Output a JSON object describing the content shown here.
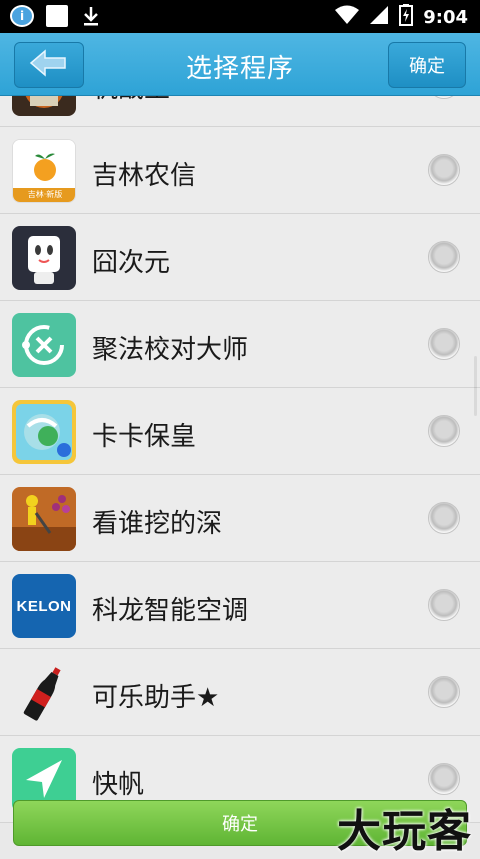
{
  "status_bar": {
    "time": "9:04",
    "notification_badge": "i",
    "icons": [
      "message-icon",
      "square-icon",
      "download-icon",
      "wifi-icon",
      "signal-icon",
      "battery-icon"
    ]
  },
  "header": {
    "title": "选择程序",
    "confirm_label": "确定",
    "accent_color": "#2ea3d6"
  },
  "apps": [
    {
      "name": "机战王",
      "icon": "mech-robot-icon",
      "selected": false
    },
    {
      "name": "吉林农信",
      "icon": "jilin-bank-icon",
      "icon_caption": "吉林·新版",
      "selected": false
    },
    {
      "name": "囧次元",
      "icon": "jiong-cartoon-icon",
      "selected": false
    },
    {
      "name": "聚法校对大师",
      "icon": "proofread-icon",
      "selected": false
    },
    {
      "name": "卡卡保皇",
      "icon": "card-game-icon",
      "selected": false
    },
    {
      "name": "看谁挖的深",
      "icon": "dig-game-icon",
      "selected": false
    },
    {
      "name": "科龙智能空调",
      "icon": "kelon-icon",
      "icon_text": "KELON",
      "selected": false
    },
    {
      "name": "可乐助手★",
      "icon": "cola-bottle-icon",
      "selected": false
    },
    {
      "name": "快帆",
      "icon": "kuaifan-icon",
      "selected": false
    }
  ],
  "footer": {
    "confirm_label": "确定",
    "button_color": "#6cc040"
  },
  "watermark": "大玩客"
}
